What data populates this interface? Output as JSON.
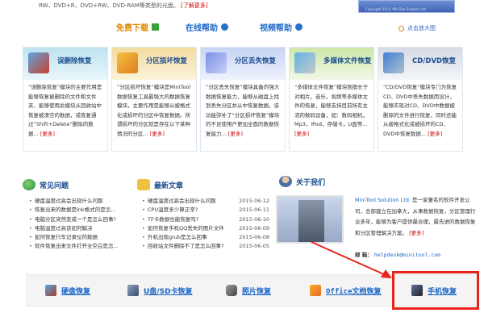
{
  "top": {
    "text": "RW、DVD+R、DVD+RW、DVD-RAM等类型的光盘。",
    "more": "[了解更多]",
    "image_caption": "Copyright 2014, MiniTool Solution Ltd."
  },
  "links": {
    "download": "免费下载",
    "help": "在线帮助",
    "video": "视频帮助",
    "screenshot": "点击放大图"
  },
  "cards": [
    {
      "title": "误删除恢复",
      "body": "“误删除恢复”模块的主要作用是能够恢复被删除的文件和文件夹，能够使用此模块从回收站中恢复被清空的数据，或恢复通过“Shift+Delete”删除的数据...",
      "more": "[更多]"
    },
    {
      "title": "分区损坏恢复",
      "body": "“分区损坏恢复”模块是MiniTool 数据恢复工具最强大的数据恢复模块，主要作用是能够从被格式化或损坏的分区中恢复数据。所谓损坏的分区就是存在以下某种情况的分区...",
      "more": "[更多]"
    },
    {
      "title": "分区丢失恢复",
      "body": "“分区丢失恢复”模块具备的强大数据恢复能力，能够从磁盘上找到丢失分区并从中恢复数据。该功能弥补了“分区损坏恢复”模块的不足使用户更加全面的数据恢复能力...",
      "more": "[更多]"
    },
    {
      "title": "多媒体文件恢复",
      "body": "“多媒体文件恢复”模块则擅长于对相片，音乐，视频等多媒体文件的恢复，能够支持目前所有主流的数码设备，如：数码相机，Mp3，iPod，存储卡，U盘等...",
      "more": "[更多]"
    },
    {
      "title": "CD/DVD恢复",
      "body": "“CD/DVD恢复”模块专门为恢复CD、DVD中丢失数据而设计，能够实现对CD、DVD中数据被删除的文件进行恢复，同时还能从被格式化或被损坏的CD、DVD中恢复数据...",
      "more": "[更多]"
    }
  ],
  "faq": {
    "title": "常见问题",
    "items": [
      "硬盘温度过高会出现什么问题",
      "恢复出来的数据是lnk格式的是怎...",
      "电脑分区突然变成一个是怎么回事?",
      "电脑温度过高该如何解决",
      "如何恢复行车记录仪的数据",
      "软件恢复出来文件打开全空白是怎..."
    ]
  },
  "news": {
    "title": "最新文章",
    "items": [
      {
        "text": "硬盘温度过高会出现什么问题",
        "date": "2015-06-12"
      },
      {
        "text": "CPU温度多少算正常?",
        "date": "2015-06-11"
      },
      {
        "text": "TF卡数据也能恢复吗?",
        "date": "2015-06-10"
      },
      {
        "text": "如何恢复手机QQ丢失的图片文件",
        "date": "2015-06-09"
      },
      {
        "text": "升机出现grub是怎么回事",
        "date": "2015-06-08"
      },
      {
        "text": "回收站文件删除不了是怎么回事?",
        "date": "2015-06-05"
      }
    ]
  },
  "about": {
    "title": "关于我们",
    "brand": "MiniTool Solution Ltd.",
    "text": "是一家著名的软件开发公司，总部建立在加拿大，从事数据恢复，分区管理行业多年，能够为客户提供最合理，最先进的数据恢复和分区管理解决方案。",
    "more": "[更多]",
    "mail_label": "邮  箱：",
    "mail": "helpdesk@minitool.com"
  },
  "bottom_nav": [
    {
      "label": "硬盘恢复",
      "icon": "hard-disk-icon"
    },
    {
      "label": "U盘/SD卡恢复",
      "icon": "usb-drive-icon"
    },
    {
      "label": "照片恢复",
      "icon": "camera-icon"
    },
    {
      "label": "Office文档恢复",
      "icon": "office-document-icon"
    },
    {
      "label": "手机恢复",
      "icon": "mobile-phone-icon"
    }
  ],
  "colors": {
    "accent_orange": "#e08a00",
    "link_blue": "#1a66c8",
    "highlight_red": "#e8231a",
    "more_red": "#cc0000"
  }
}
